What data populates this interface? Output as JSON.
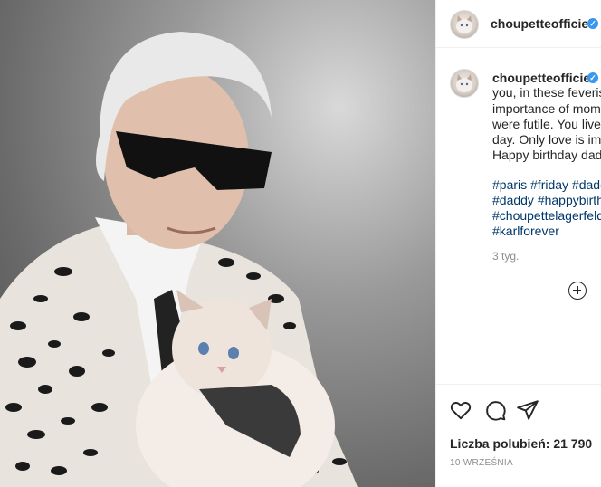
{
  "post": {
    "username": "choupetteofficiel",
    "caption_username": "choupetteofficiel",
    "caption_lines": [
      "you, in these feverish",
      "importance of mome",
      "were futile. You live b",
      "day. Only love is imm",
      "Happy birthday dadd"
    ],
    "hashtags": [
      "#paris #friday #dadd",
      "#daddy #happybirth",
      "#choupettelagerfeld",
      "#karlforever"
    ],
    "time_ago": "3 tyg.",
    "likes": "Liczba polubień: 21 790",
    "date": "10 WRZEŚNIA"
  },
  "icons": {
    "like": "heart-icon",
    "comment": "comment-icon",
    "share": "share-icon",
    "add_comment": "plus-circle-icon",
    "verified": "verified-badge-icon"
  },
  "colors": {
    "verified": "#3897f0",
    "hashtag": "#00376b",
    "muted": "#8e8e8e"
  }
}
